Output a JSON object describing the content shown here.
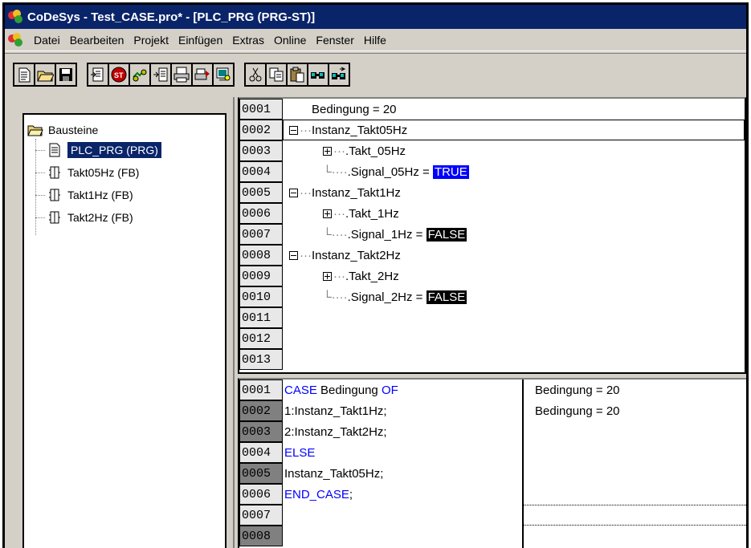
{
  "window": {
    "title": "CoDeSys - Test_CASE.pro* - [PLC_PRG (PRG-ST)]"
  },
  "menu": {
    "items": [
      "Datei",
      "Bearbeiten",
      "Projekt",
      "Einfügen",
      "Extras",
      "Online",
      "Fenster",
      "Hilfe"
    ]
  },
  "toolbar": {
    "buttons": [
      "new-icon",
      "open-icon",
      "save-icon",
      "login-icon",
      "stop-icon",
      "run-icon",
      "step-icon",
      "print-icon",
      "print-preview-icon",
      "find-icon",
      "cut-icon",
      "copy-icon",
      "paste-icon",
      "find-next-icon",
      "replace-icon"
    ]
  },
  "tree": {
    "root": "Bausteine",
    "items": [
      "PLC_PRG (PRG)",
      "Takt05Hz (FB)",
      "Takt1Hz (FB)",
      "Takt2Hz (FB)"
    ]
  },
  "declaration": {
    "line_numbers": [
      "0001",
      "0002",
      "0003",
      "0004",
      "0005",
      "0006",
      "0007",
      "0008",
      "0009",
      "0010",
      "0011",
      "0012",
      "0013"
    ],
    "lines": {
      "l1": "Bedingung = 20",
      "l2": "Instanz_Takt05Hz",
      "l3": ".Takt_05Hz",
      "l4": ".Signal_05Hz = ",
      "l4_value": "TRUE",
      "l5": "Instanz_Takt1Hz",
      "l6": ".Takt_1Hz",
      "l7": ".Signal_1Hz = ",
      "l7_value": "FALSE",
      "l8": "Instanz_Takt2Hz",
      "l9": ".Takt_2Hz",
      "l10": ".Signal_2Hz = ",
      "l10_value": "FALSE"
    }
  },
  "code": {
    "line_numbers": [
      "0001",
      "0002",
      "0003",
      "0004",
      "0005",
      "0006",
      "0007",
      "0008"
    ],
    "l1_kw1": "CASE",
    "l1_mid": " Bedingung ",
    "l1_kw2": "OF",
    "l2": "1:Instanz_Takt1Hz;",
    "l3": "2:Instanz_Takt2Hz;",
    "l4_kw": "ELSE",
    "l5": "Instanz_Takt05Hz;",
    "l6_kw": "END_CASE",
    "l6_end": ";"
  },
  "monitor": {
    "lines": [
      "Bedingung = 20",
      "Bedingung = 20"
    ]
  },
  "colors": {
    "titlebar": "#0a246a",
    "keyword": "#0000ff",
    "true_bg": "#0000ff",
    "false_bg": "#000000"
  }
}
